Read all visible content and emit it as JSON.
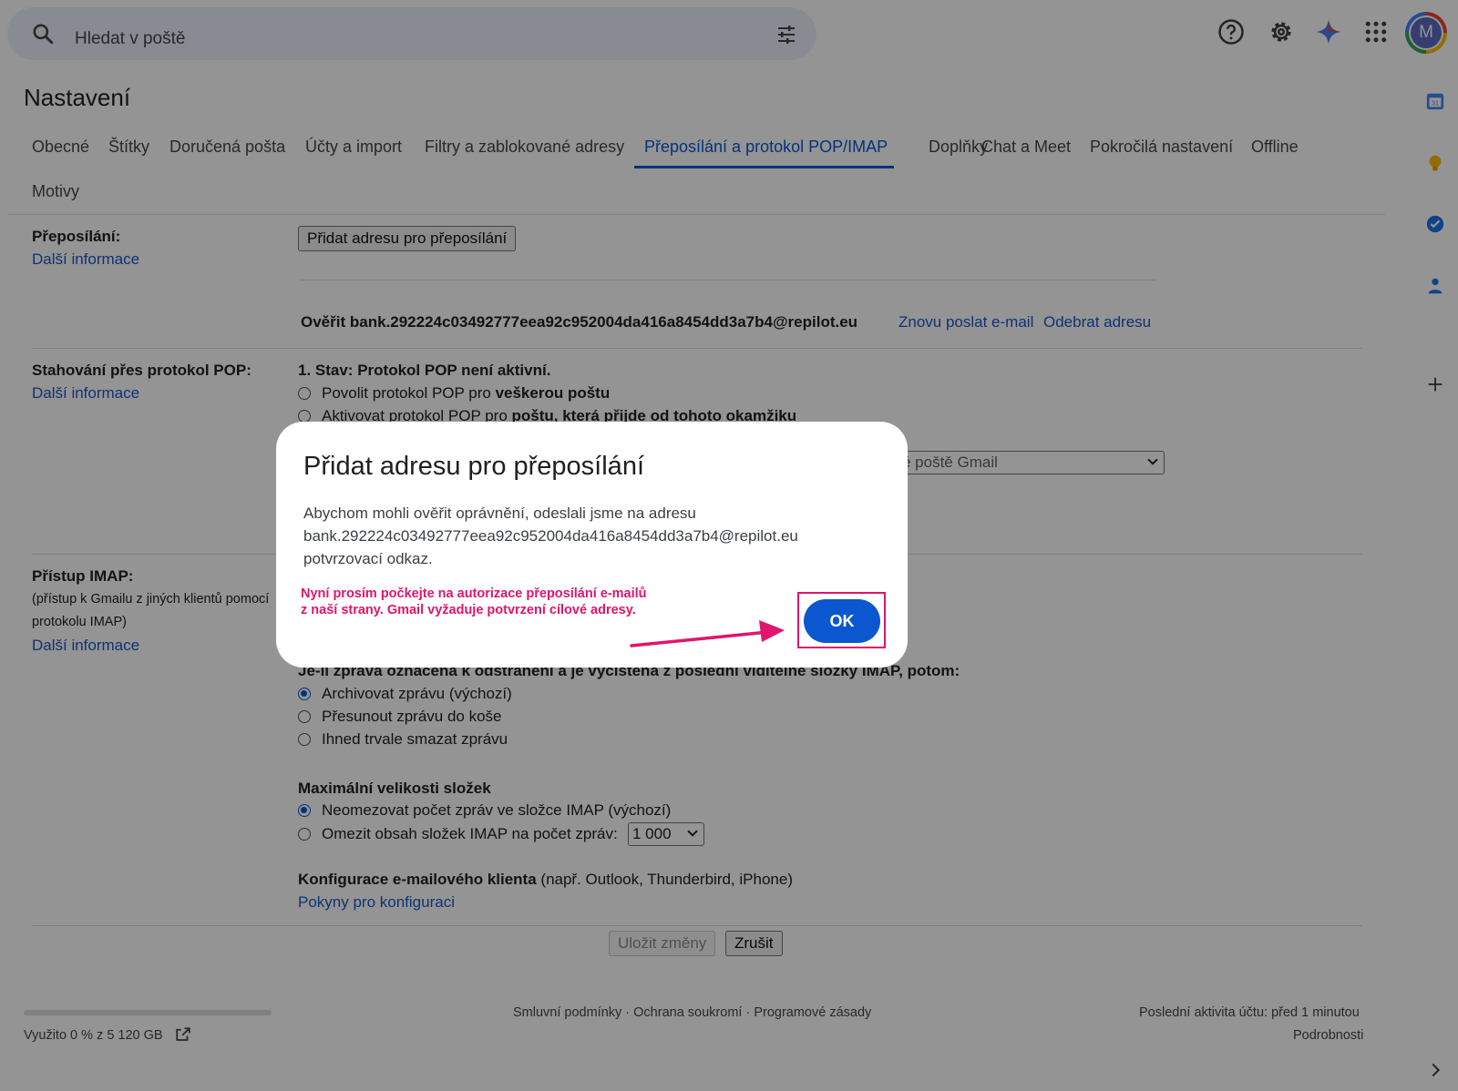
{
  "search": {
    "placeholder": "Hledat v poště"
  },
  "header": {
    "avatar_letter": "M"
  },
  "page_title": "Nastavení",
  "tabs": [
    {
      "label": "Obecné"
    },
    {
      "label": "Štítky"
    },
    {
      "label": "Doručená pošta"
    },
    {
      "label": "Účty a import"
    },
    {
      "label": "Filtry a zablokované adresy"
    },
    {
      "label": "Přeposílání a protokol POP/IMAP",
      "active": true
    },
    {
      "label": "Doplňky"
    },
    {
      "label": "Chat a Meet"
    },
    {
      "label": "Pokročilá nastavení"
    },
    {
      "label": "Offline"
    },
    {
      "label": "Motivy"
    }
  ],
  "forwarding": {
    "label": "Přeposílání:",
    "more_info": "Další informace",
    "add_button": "Přidat adresu pro přeposílání",
    "verify_text": "Ověřit bank.292224c03492777eea92c952004da416a8454dd3a7b4@repilot.eu",
    "resend_link": "Znovu poslat e-mail",
    "remove_link": "Odebrat adresu"
  },
  "pop": {
    "label": "Stahování přes protokol POP:",
    "more_info": "Další informace",
    "status": "1. Stav: Protokol POP není aktivní.",
    "option1_prefix": "Povolit protokol POP pro ",
    "option1_bold": "veškerou poštu",
    "option2_prefix": "Aktivovat protokol POP pro ",
    "option2_bold": "poštu, která přijde od tohoto okamžiku",
    "select_value": "é poště Gmail"
  },
  "imap": {
    "label": "Přístup IMAP:",
    "desc_line1": "(přístup k Gmailu z jiných klientů pomocí",
    "desc_line2": "protokolu IMAP)",
    "more_info": "Další informace",
    "expunge_heading": "Je-li zpráva označena k odstranění a je vyčištěna z poslední viditelné složky IMAP, potom:",
    "expunge_options": [
      {
        "label": "Archivovat zprávu (výchozí)",
        "checked": true
      },
      {
        "label": "Přesunout zprávu do koše",
        "checked": false
      },
      {
        "label": "Ihned trvale smazat zprávu",
        "checked": false
      }
    ],
    "folder_size_heading": "Maximální velikosti složek",
    "folder_options": [
      {
        "label": "Neomezovat počet zpráv ve složce IMAP (výchozí)",
        "checked": true
      },
      {
        "label": "Omezit obsah složek IMAP na počet zpráv:",
        "checked": false
      }
    ],
    "folder_limit_value": "1 000",
    "client_config_bold": "Konfigurace e-mailového klienta",
    "client_config_rest": " (např. Outlook, Thunderbird, iPhone)",
    "client_config_link": "Pokyny pro konfiguraci"
  },
  "actions": {
    "save": "Uložit změny",
    "cancel": "Zrušit"
  },
  "footer": {
    "storage": "Využito 0 % z 5 120 GB",
    "links": "Smluvní podmínky · Ochrana soukromí · Programové zásady",
    "activity": "Poslední aktivita účtu: před 1 minutou",
    "details": "Podrobnosti"
  },
  "dialog": {
    "title": "Přidat adresu pro přeposílání",
    "body_line1": "Abychom mohli ověřit oprávnění, odeslali jsme na adresu",
    "body_line2": "bank.292224c03492777eea92c952004da416a8454dd3a7b4@repilot.eu",
    "body_line3": "potvrzovací odkaz.",
    "note_line1": "Nyní prosím počkejte na autorizace přeposílání e-mailů",
    "note_line2": "z naší strany. Gmail vyžaduje potvrzení cílové adresy.",
    "ok": "OK"
  },
  "colors": {
    "accent": "#0b57d0",
    "annotation": "#e0156b",
    "link": "#1a57c9"
  },
  "icons": [
    "search-icon",
    "tune-icon",
    "help-icon",
    "gear-icon",
    "gemini-icon",
    "apps-icon",
    "calendar-icon",
    "keep-icon",
    "tasks-icon",
    "contacts-icon",
    "plus-icon",
    "chevron-right-icon",
    "open-external-icon"
  ]
}
